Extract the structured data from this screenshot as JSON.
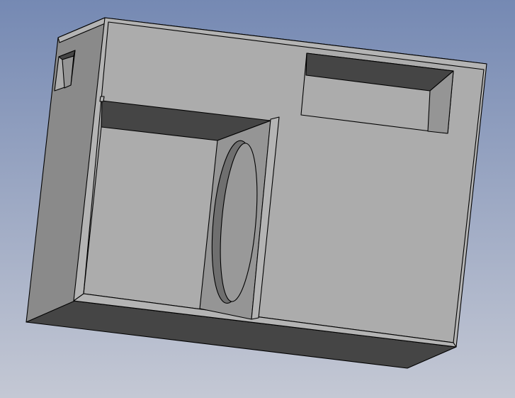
{
  "colors": {
    "background_top": "#7589b3",
    "background_bottom": "#c4c8d4",
    "face_light": "#acacac",
    "face_frame": "#b4b4b4",
    "face_side": "#8a8a8a",
    "face_dark": "#454545",
    "face_mid": "#959595"
  }
}
